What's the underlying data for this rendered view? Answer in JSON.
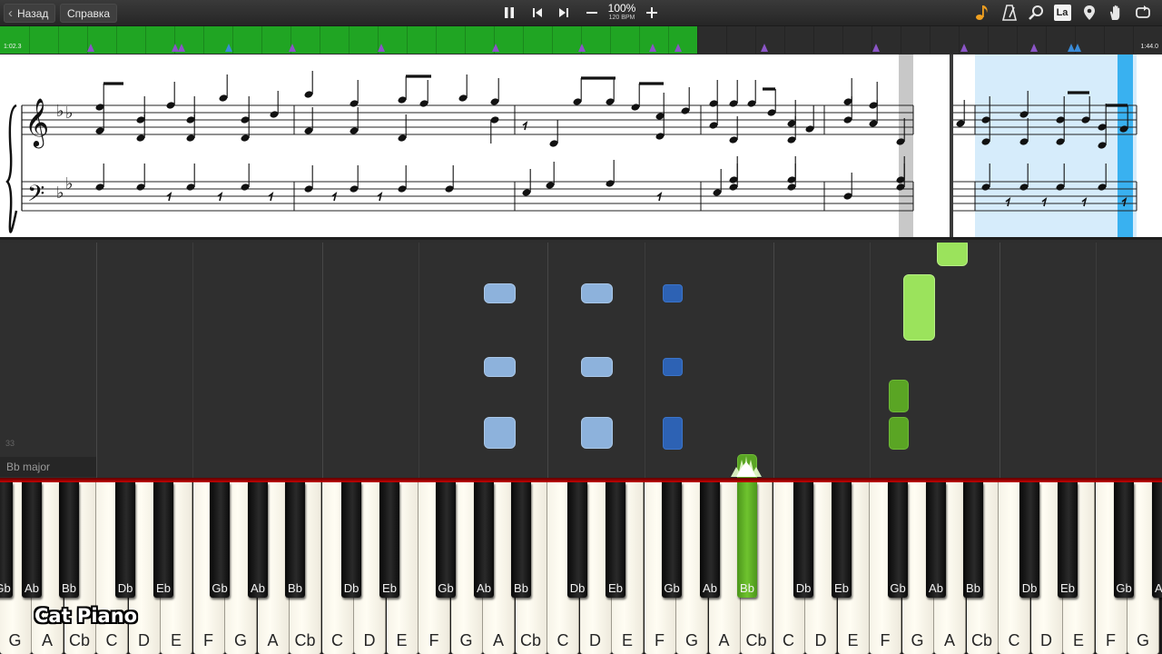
{
  "toolbar": {
    "back_label": "Назад",
    "help_label": "Справка",
    "speed_percent": "100%",
    "speed_bpm": "120 BPM",
    "icons": [
      "pause-icon",
      "skip-back-icon",
      "skip-forward-icon",
      "minus-icon",
      "plus-icon",
      "note-icon",
      "metronome-icon",
      "magnifier-icon",
      "letter-notation-icon",
      "location-pin-icon",
      "hand-icon",
      "loop-icon"
    ],
    "notation_badge": "La"
  },
  "timeline": {
    "time_current": "1:02.3",
    "time_total": "1:44.0",
    "progress_fraction": 0.6
  },
  "roll": {
    "measure_number": "33",
    "key_signature": "Bb major"
  },
  "keyboard": {
    "white_keys": [
      "G",
      "A",
      "Cb",
      "C",
      "D",
      "E",
      "F",
      "G",
      "A",
      "Cb",
      "C",
      "D",
      "E",
      "F",
      "G",
      "A",
      "Cb",
      "C",
      "D",
      "E",
      "F",
      "G",
      "A",
      "Cb",
      "C",
      "D",
      "E",
      "F",
      "G",
      "A",
      "Cb",
      "C",
      "D",
      "E",
      "F",
      "G"
    ],
    "black_keys": [
      "Gb",
      "Ab",
      "Bb",
      "Db",
      "Eb",
      "Gb",
      "Ab",
      "Bb",
      "Db",
      "Eb",
      "Gb",
      "Ab",
      "Bb",
      "Db",
      "Eb",
      "Gb",
      "Ab",
      "Bb",
      "Db",
      "Eb",
      "Gb",
      "Ab",
      "Bb",
      "Db",
      "Eb",
      "Gb",
      "Ab"
    ],
    "pressed_key": "Bb"
  },
  "branding": {
    "logo_text": "Cat Piano"
  },
  "colors": {
    "timeline_progress": "#20a523",
    "left_hand_note": "#8db2dc",
    "left_hand_active": "#2d62b4",
    "right_hand_note": "#9be35c",
    "right_hand_active": "#5aa524",
    "pressed_key": "#6fc32f",
    "divider": "#c70000"
  }
}
